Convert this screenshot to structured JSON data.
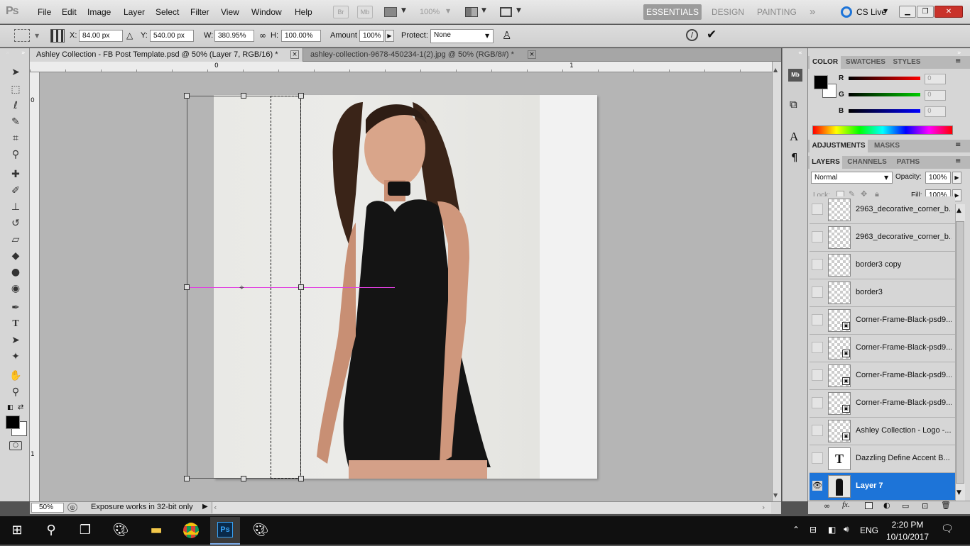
{
  "menu": {
    "logo": "Ps",
    "items": [
      "File",
      "Edit",
      "Image",
      "Layer",
      "Select",
      "Filter",
      "View",
      "Window",
      "Help"
    ],
    "br": "Br",
    "mb": "Mb",
    "zoom_level": "100%",
    "workspaces": [
      "ESSENTIALS",
      "DESIGN",
      "PAINTING"
    ],
    "more_ws": "»",
    "cs_live": "CS Live"
  },
  "options": {
    "x_label": "X:",
    "x_value": "84.00 px",
    "y_label": "Y:",
    "y_value": "540.00 px",
    "w_label": "W:",
    "w_value": "380.95%",
    "h_label": "H:",
    "h_value": "100.00%",
    "amount_label": "Amount",
    "amount_value": "100%",
    "protect_label": "Protect:",
    "protect_value": "None"
  },
  "tabs": [
    {
      "label": "Ashley Collection - FB Post Template.psd @ 50% (Layer 7, RGB/16) *",
      "close": "×"
    },
    {
      "label": "ashley-collection-9678-450234-1(2).jpg @ 50% (RGB/8#) *",
      "close": "×"
    }
  ],
  "ruler": {
    "h_ticks": [
      "0",
      "1"
    ],
    "v_ticks": [
      "0",
      "1"
    ]
  },
  "status": {
    "zoom": "50%",
    "message": "Exposure works in 32-bit only"
  },
  "color_panel": {
    "tabs": [
      "COLOR",
      "SWATCHES",
      "STYLES"
    ],
    "r_label": "R",
    "g_label": "G",
    "b_label": "B",
    "r_value": "0",
    "g_value": "0",
    "b_value": "0"
  },
  "adjust_panel": {
    "tabs": [
      "ADJUSTMENTS",
      "MASKS"
    ]
  },
  "layers_panel": {
    "tabs": [
      "LAYERS",
      "CHANNELS",
      "PATHS"
    ],
    "blend_mode": "Normal",
    "opacity_label": "Opacity:",
    "opacity_value": "100%",
    "lock_label": "Lock:",
    "fill_label": "Fill:",
    "fill_value": "100%",
    "layers": [
      {
        "name": "2963_decorative_corner_b...",
        "type": "raster"
      },
      {
        "name": "2963_decorative_corner_b...",
        "type": "raster"
      },
      {
        "name": "border3 copy",
        "type": "raster"
      },
      {
        "name": "border3",
        "type": "raster"
      },
      {
        "name": "Corner-Frame-Black-psd9...",
        "type": "smart"
      },
      {
        "name": "Corner-Frame-Black-psd9...",
        "type": "smart"
      },
      {
        "name": "Corner-Frame-Black-psd9...",
        "type": "smart"
      },
      {
        "name": "Corner-Frame-Black-psd9...",
        "type": "smart"
      },
      {
        "name": "Ashley Collection - Logo -...",
        "type": "smart"
      },
      {
        "name": "Dazzling Define  Accent B...",
        "type": "text"
      },
      {
        "name": "Layer 7",
        "type": "photo",
        "selected": true
      }
    ]
  },
  "taskbar": {
    "time": "2:20 PM",
    "date": "10/10/2017",
    "lang": "ENG"
  },
  "colors": {
    "selected_layer": "#1d74d8",
    "guide": "#e040e0",
    "canvas_bg": "#b5b5b5"
  }
}
